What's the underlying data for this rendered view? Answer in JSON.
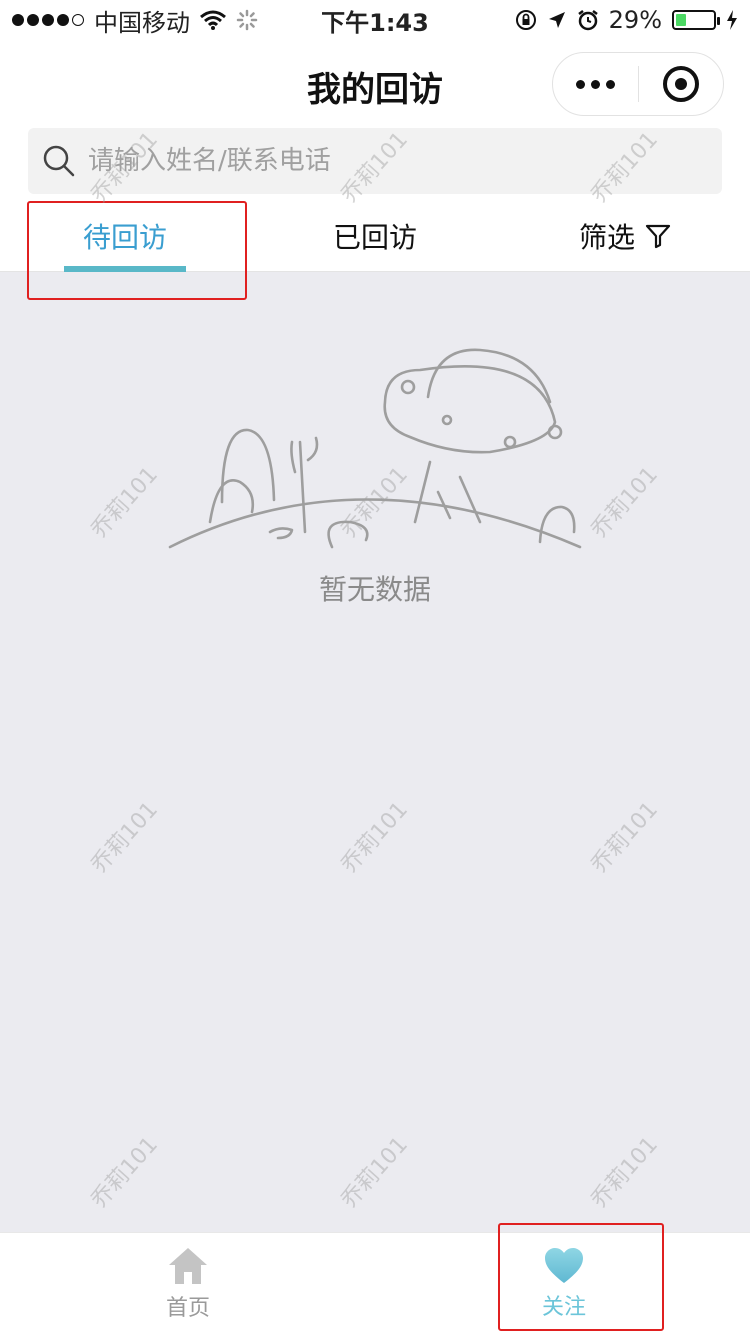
{
  "status_bar": {
    "carrier": "中国移动",
    "time": "下午1:43",
    "battery_percent": "29%",
    "battery_level": 0.29,
    "icons": [
      "signal-dots",
      "wifi-icon",
      "loading-icon",
      "rotation-lock-icon",
      "location-arrow-icon",
      "alarm-icon",
      "battery-icon",
      "charging-bolt-icon"
    ]
  },
  "nav": {
    "title": "我的回访",
    "capsule_icons": [
      "more-dots-icon",
      "target-close-icon"
    ]
  },
  "search": {
    "placeholder": "请输入姓名/联系电话",
    "value": ""
  },
  "tabs": {
    "pending": "待回访",
    "done": "已回访",
    "filter": "筛选",
    "active": "pending"
  },
  "empty_state": {
    "text": "暂无数据",
    "illustration": "ufo-landscape-illustration"
  },
  "watermark": "乔莉101",
  "tabbar": {
    "home_label": "首页",
    "follow_label": "关注",
    "active": "follow"
  },
  "colors": {
    "accent": "#3a9ed0",
    "underline": "#59b8c8",
    "follow_active": "#6cc5d9",
    "highlight_box": "#e02020",
    "page_bg": "#ebebf0"
  }
}
